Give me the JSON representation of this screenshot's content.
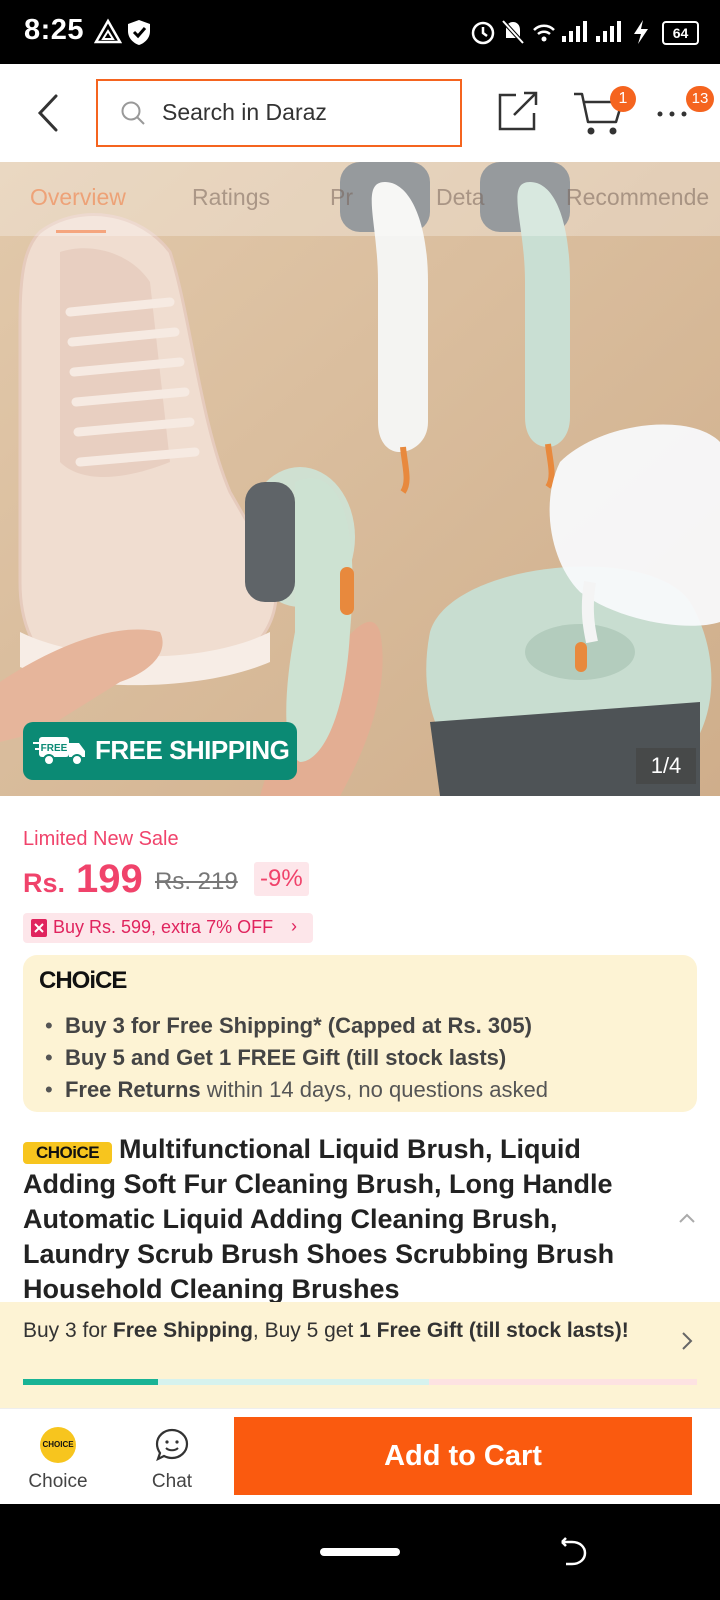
{
  "status_bar": {
    "time": "8:25",
    "battery": "64"
  },
  "header": {
    "search_placeholder": "Search in Daraz",
    "cart_count": "1",
    "more_count": "13"
  },
  "gallery": {
    "tabs": [
      "Overview",
      "Ratings",
      "Pr",
      "Deta",
      "Recommende"
    ],
    "free_shipping_badge": "FREE SHIPPING",
    "free_icon_label": "FREE",
    "page_counter": "1/4"
  },
  "price": {
    "sale_label": "Limited New Sale",
    "currency": "Rs.",
    "value": "199",
    "old_price": "Rs. 219",
    "discount": "-9%",
    "promo": "Buy Rs. 599, extra 7% OFF"
  },
  "choice_box": {
    "logo": "CHOiCE",
    "bullets": [
      {
        "bold": "Buy 3 for  Free Shipping* (Capped at Rs. 305)",
        "rest": ""
      },
      {
        "bold": "Buy 5 and Get 1 FREE Gift (till stock lasts)",
        "rest": ""
      },
      {
        "bold": "Free Returns",
        "rest": " within 14 days, no questions asked"
      }
    ]
  },
  "product": {
    "tag": "CHOiCE",
    "title": "Multifunctional Liquid Brush, Liquid Adding Soft Fur Cleaning Brush, Long Handle Automatic Liquid Adding Cleaning Brush, Laundry Scrub Brush Shoes Scrubbing Brush Household Cleaning Brushes"
  },
  "shipping_banner": {
    "part1": "Buy 3 for ",
    "part2": "Free Shipping",
    "part3": ", Buy 5 get ",
    "part4": "1 Free Gift (till stock lasts)!",
    "progress": 0.2
  },
  "bottom_bar": {
    "choice_coin": "CHOICE",
    "choice_label": "Choice",
    "chat_label": "Chat",
    "add_to_cart": "Add to Cart"
  },
  "colors": {
    "accent": "#f5641f",
    "sale": "#f0436b",
    "choice_yellow": "#f7c51e",
    "free_ship_green": "#0b8a74"
  }
}
